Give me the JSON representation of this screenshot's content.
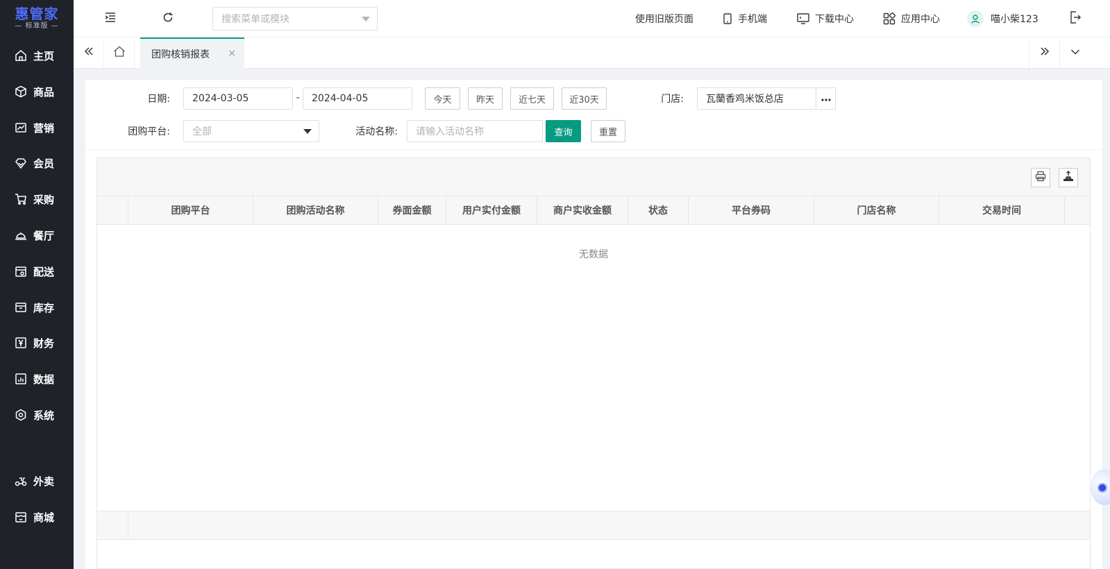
{
  "sidebar": {
    "logo_title": "惠管家",
    "logo_subtitle": "— 标准版 —",
    "items": [
      {
        "label": "主页",
        "icon": "home-icon"
      },
      {
        "label": "商品",
        "icon": "cube-icon"
      },
      {
        "label": "营销",
        "icon": "trend-chart-icon"
      },
      {
        "label": "会员",
        "icon": "member-diamond-icon"
      },
      {
        "label": "采购",
        "icon": "cart-icon"
      },
      {
        "label": "餐厅",
        "icon": "dining-bell-icon"
      },
      {
        "label": "配送",
        "icon": "delivery-store-icon"
      },
      {
        "label": "库存",
        "icon": "inventory-box-icon"
      },
      {
        "label": "财务",
        "icon": "finance-yen-icon"
      },
      {
        "label": "数据",
        "icon": "data-bar-icon"
      },
      {
        "label": "系统",
        "icon": "system-gear-icon"
      },
      {
        "label": "外卖",
        "icon": "scooter-icon"
      },
      {
        "label": "商城",
        "icon": "mall-shop-icon"
      }
    ]
  },
  "header": {
    "search_placeholder": "搜索菜单或模块",
    "old_version": "使用旧版页面",
    "mobile": "手机端",
    "download": "下载中心",
    "app_center": "应用中心",
    "username": "喵小柴123"
  },
  "tabs": {
    "active_label": "团购核销报表",
    "close": "×"
  },
  "filters": {
    "date_label": "日期:",
    "date_start": "2024-03-05",
    "date_sep": "-",
    "date_end": "2024-04-05",
    "quick_today": "今天",
    "quick_yesterday": "昨天",
    "quick_7days": "近七天",
    "quick_30days": "近30天",
    "store_label": "门店:",
    "store_value": "瓦蘭香鸡米饭总店",
    "platform_label": "团购平台:",
    "platform_value": "全部",
    "activity_label": "活动名称:",
    "activity_placeholder": "请输入活动名称",
    "query_button": "查询",
    "reset_button": "重置"
  },
  "table": {
    "columns": [
      "团购平台",
      "团购活动名称",
      "券面金额",
      "用户实付金额",
      "商户实收金额",
      "状态",
      "平台券码",
      "门店名称",
      "交易时间"
    ],
    "rows": [],
    "empty_text": "无数据"
  },
  "colors": {
    "sidebar_bg": "#20222a",
    "brand": "#4f6cf7",
    "primary": "#079b82"
  }
}
